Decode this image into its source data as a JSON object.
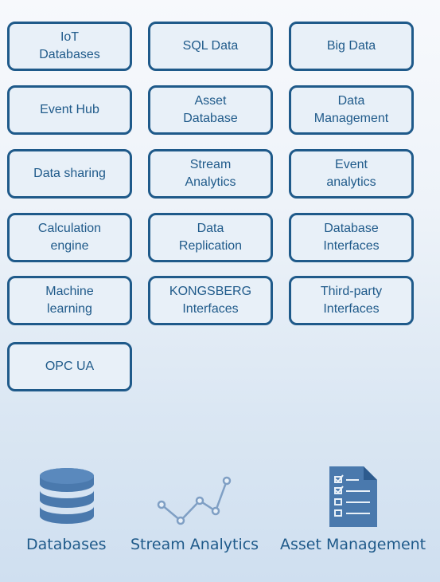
{
  "tiles": [
    "IoT\nDatabases",
    "SQL Data",
    "Big Data",
    "Event Hub",
    "Asset\nDatabase",
    "Data\nManagement",
    "Data sharing",
    "Stream\nAnalytics",
    "Event\nanalytics",
    "Calculation\nengine",
    "Data\nReplication",
    "Database\nInterfaces",
    "Machine\nlearning",
    "KONGSBERG\nInterfaces",
    "Third-party\nInterfaces",
    "OPC UA"
  ],
  "legend": {
    "databases": "Databases",
    "stream_analytics": "Stream Analytics",
    "asset_management": "Asset Management"
  },
  "colors": {
    "primary": "#1f5a8a",
    "tile_fill": "#e8f0f8",
    "icon_fill": "#4a79ad",
    "line_icon": "#7f9fc4"
  }
}
